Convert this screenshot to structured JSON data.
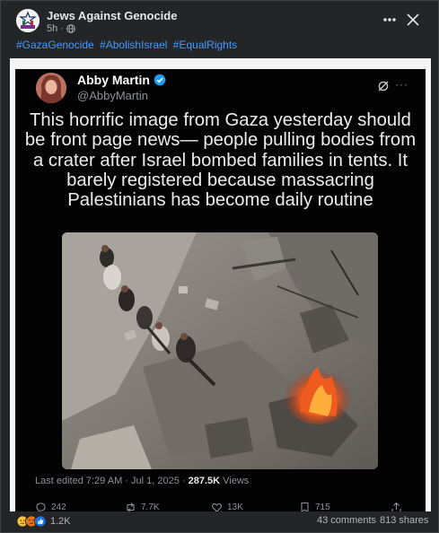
{
  "post": {
    "page_name": "Jews Against Genocide",
    "time": "5h",
    "separator": "·",
    "privacy_icon": "globe-icon",
    "hashtags": [
      "#GazaGenocide",
      "#AbolishIsrael",
      "#EqualRights"
    ],
    "more_icon": "more-horizontal-icon",
    "close_icon": "close-icon"
  },
  "tweet": {
    "name": "Abby Martin",
    "handle": "@AbbyMartin",
    "text": "This horrific image from Gaza yesterday should be front page news— people pulling bodies from a crater after Israel bombed families in tents. It barely registered because massacring Palestinians has become daily routine",
    "edited": "Last edited 7:29 AM · Jul 1, 2025 · ",
    "views_count": "287.5K",
    "views_label": " Views",
    "actions": [
      {
        "icon": "reply-icon",
        "count": "242"
      },
      {
        "icon": "retweet-icon",
        "count": "7.7K"
      },
      {
        "icon": "like-icon",
        "count": "13K"
      },
      {
        "icon": "bookmark-icon",
        "count": "715"
      },
      {
        "icon": "share-icon",
        "count": ""
      }
    ]
  },
  "footer": {
    "reaction_icons": [
      "sad-icon",
      "angry-icon",
      "like-icon"
    ],
    "reactions_count": "1.2K",
    "comments": "43 comments",
    "shares": "813 shares"
  },
  "colors": {
    "link": "#4599ff",
    "card_bg": "#242526",
    "tweet_bg": "#030303",
    "fire": "#e8501c"
  }
}
